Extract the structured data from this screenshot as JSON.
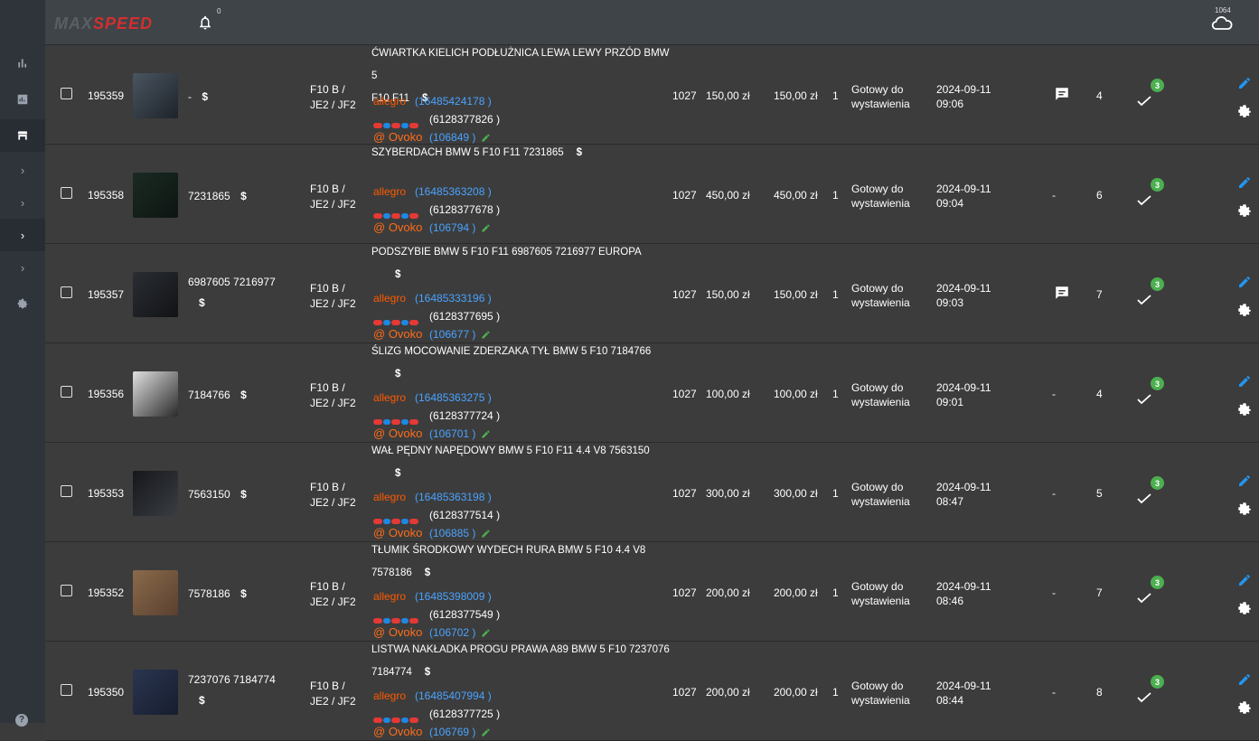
{
  "header": {
    "logo_part1": "MAX",
    "logo_part2": "SPEED",
    "bell_icon": "bell-icon",
    "notifications_count": "0",
    "cloud_icon": "cloud-icon",
    "cloud_count": "1064"
  },
  "sidebar": {
    "items": [
      {
        "icon": "bar-chart-icon"
      },
      {
        "icon": "image-chart-icon"
      },
      {
        "icon": "store-icon"
      },
      {
        "icon": "chevron-right-icon"
      },
      {
        "icon": "chevron-right-icon"
      },
      {
        "icon": "chevron-right-icon"
      },
      {
        "icon": "chevron-right-icon"
      },
      {
        "icon": "gear-icon"
      },
      {
        "icon": "help-icon"
      }
    ],
    "help_label": "?"
  },
  "colors": {
    "background": "#3c3c3c",
    "topbar": "#3f4449",
    "sidebar": "#2f343b",
    "link": "#4aa3ff",
    "allegro": "#ff5a00",
    "ovoko": "#ff6d1a",
    "badge": "#4caf50",
    "edit": "#2196f3"
  },
  "rows": [
    {
      "id": "195359",
      "part_no": "-",
      "dollar": "$",
      "model_line1": "F10 B /",
      "model_line2": "JE2 / JF2",
      "title_line1": "ĆWIARTKA KIELICH PODŁUŻNICA LEWA LEWY PRZÓD BMW 5",
      "title_line2": "F10 F11",
      "allegro_label": "allegro",
      "allegro_id": "(16485424178 )",
      "gumtree_id": "(6128377826 )",
      "ovoko_label": "Ovoko",
      "ovoko_id": "(106849 )",
      "qty_code": "1027",
      "price1": "150,00 zł",
      "price2": "150,00 zł",
      "qty": "1",
      "status_line1": "Gotowy do",
      "status_line2": "wystawienia",
      "date": "2024-09-11",
      "time": "09:06",
      "comment": "comment-icon",
      "count": "4",
      "badge": "3"
    },
    {
      "id": "195358",
      "part_no": "7231865",
      "dollar": "$",
      "model_line1": "F10 B /",
      "model_line2": "JE2 / JF2",
      "title_line1": "SZYBERDACH BMW 5 F10 F11 7231865",
      "title_line2": "",
      "allegro_label": "allegro",
      "allegro_id": "(16485363208 )",
      "gumtree_id": "(6128377678 )",
      "ovoko_label": "Ovoko",
      "ovoko_id": "(106794 )",
      "qty_code": "1027",
      "price1": "450,00 zł",
      "price2": "450,00 zł",
      "qty": "1",
      "status_line1": "Gotowy do",
      "status_line2": "wystawienia",
      "date": "2024-09-11",
      "time": "09:04",
      "comment": "-",
      "count": "6",
      "badge": "3"
    },
    {
      "id": "195357",
      "part_no": "6987605 7216977",
      "dollar": "$",
      "model_line1": "F10 B /",
      "model_line2": "JE2 / JF2",
      "title_line1": "PODSZYBIE BMW 5 F10 F11 6987605 7216977 EUROPA",
      "title_line2": "",
      "allegro_label": "allegro",
      "allegro_id": "(16485333196 )",
      "gumtree_id": "(6128377695 )",
      "ovoko_label": "Ovoko",
      "ovoko_id": "(106677 )",
      "qty_code": "1027",
      "price1": "150,00 zł",
      "price2": "150,00 zł",
      "qty": "1",
      "status_line1": "Gotowy do",
      "status_line2": "wystawienia",
      "date": "2024-09-11",
      "time": "09:03",
      "comment": "comment-icon",
      "count": "7",
      "badge": "3"
    },
    {
      "id": "195356",
      "part_no": "7184766",
      "dollar": "$",
      "model_line1": "F10 B /",
      "model_line2": "JE2 / JF2",
      "title_line1": "ŚLIZG MOCOWANIE ZDERZAKA TYŁ BMW 5 F10 7184766",
      "title_line2": "",
      "allegro_label": "allegro",
      "allegro_id": "(16485363275 )",
      "gumtree_id": "(6128377724 )",
      "ovoko_label": "Ovoko",
      "ovoko_id": "(106701 )",
      "qty_code": "1027",
      "price1": "100,00 zł",
      "price2": "100,00 zł",
      "qty": "1",
      "status_line1": "Gotowy do",
      "status_line2": "wystawienia",
      "date": "2024-09-11",
      "time": "09:01",
      "comment": "-",
      "count": "4",
      "badge": "3"
    },
    {
      "id": "195353",
      "part_no": "7563150",
      "dollar": "$",
      "model_line1": "F10 B /",
      "model_line2": "JE2 / JF2",
      "title_line1": "WAŁ PĘDNY NAPĘDOWY BMW 5 F10 F11 4.4 V8 7563150",
      "title_line2": "",
      "allegro_label": "allegro",
      "allegro_id": "(16485363198 )",
      "gumtree_id": "(6128377514 )",
      "ovoko_label": "Ovoko",
      "ovoko_id": "(106885 )",
      "qty_code": "1027",
      "price1": "300,00 zł",
      "price2": "300,00 zł",
      "qty": "1",
      "status_line1": "Gotowy do",
      "status_line2": "wystawienia",
      "date": "2024-09-11",
      "time": "08:47",
      "comment": "-",
      "count": "5",
      "badge": "3"
    },
    {
      "id": "195352",
      "part_no": "7578186",
      "dollar": "$",
      "model_line1": "F10 B /",
      "model_line2": "JE2 / JF2",
      "title_line1": "TŁUMIK ŚRODKOWY WYDECH RURA BMW 5 F10 4.4 V8",
      "title_line2": "7578186",
      "allegro_label": "allegro",
      "allegro_id": "(16485398009 )",
      "gumtree_id": "(6128377549 )",
      "ovoko_label": "Ovoko",
      "ovoko_id": "(106702 )",
      "qty_code": "1027",
      "price1": "200,00 zł",
      "price2": "200,00 zł",
      "qty": "1",
      "status_line1": "Gotowy do",
      "status_line2": "wystawienia",
      "date": "2024-09-11",
      "time": "08:46",
      "comment": "-",
      "count": "7",
      "badge": "3"
    },
    {
      "id": "195350",
      "part_no": "7237076 7184774",
      "dollar": "$",
      "model_line1": "F10 B /",
      "model_line2": "JE2 / JF2",
      "title_line1": "LISTWA NAKŁADKA PROGU PRAWA A89 BMW 5 F10 7237076",
      "title_line2": "7184774",
      "allegro_label": "allegro",
      "allegro_id": "(16485407994 )",
      "gumtree_id": "(6128377725 )",
      "ovoko_label": "Ovoko",
      "ovoko_id": "(106769 )",
      "qty_code": "1027",
      "price1": "200,00 zł",
      "price2": "200,00 zł",
      "qty": "1",
      "status_line1": "Gotowy do",
      "status_line2": "wystawienia",
      "date": "2024-09-11",
      "time": "08:44",
      "comment": "-",
      "count": "8",
      "badge": "3"
    }
  ]
}
